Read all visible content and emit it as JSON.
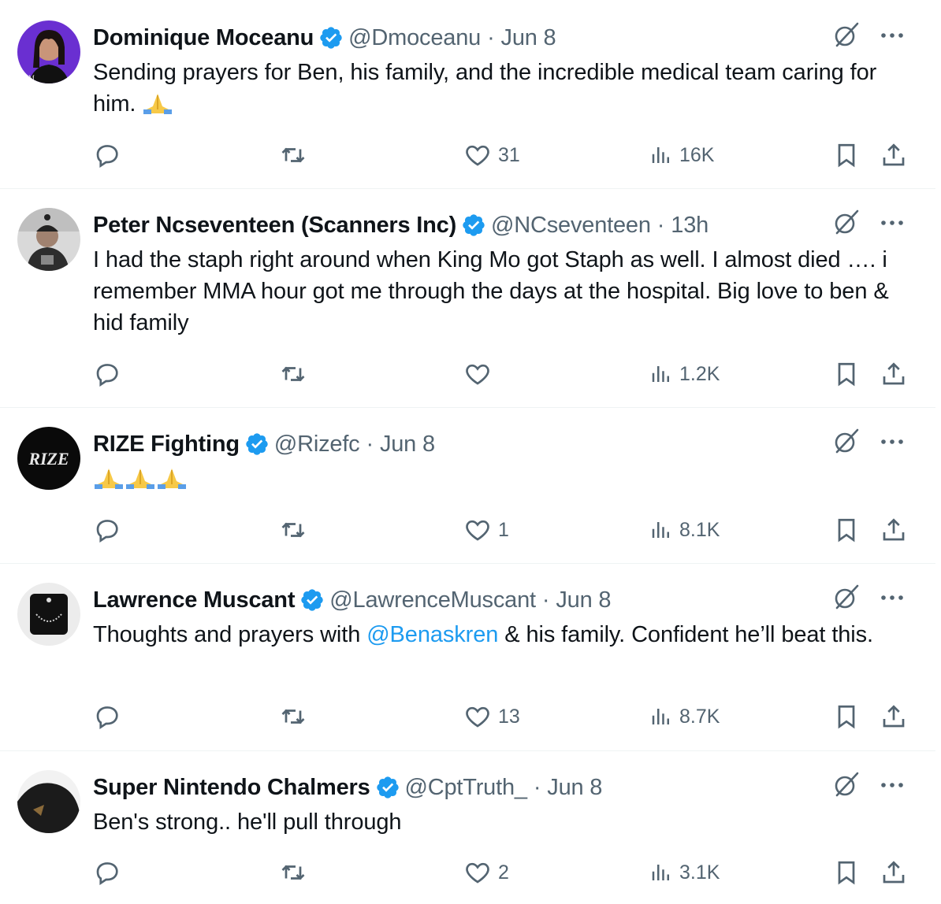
{
  "colors": {
    "verified": "#1d9bf0",
    "link": "#1d9bf0",
    "muted": "#536471"
  },
  "icons": {
    "verified": "verified-badge-icon",
    "grok": "grok-icon",
    "more": "more-icon",
    "reply": "reply-icon",
    "repost": "repost-icon",
    "like": "like-icon",
    "views": "views-icon",
    "bookmark": "bookmark-icon",
    "share": "share-icon",
    "emoji": "folded-hands-emoji"
  },
  "tweets": [
    {
      "name": "Dominique Moceanu",
      "handle": "@Dmoceanu",
      "time": "Jun 8",
      "text": "Sending prayers for Ben, his family, and the incredible medical team caring for him.",
      "likes": "31",
      "views": "16K"
    },
    {
      "name": "Peter Ncseventeen (Scanners Inc)",
      "handle": "@NCseventeen",
      "time": "13h",
      "text": "I had the staph right around when King Mo got Staph as well. I almost died …. i remember MMA hour got me through the days at the hospital. Big love to ben & hid family",
      "likes": "",
      "views": "1.2K"
    },
    {
      "name": "RIZE Fighting",
      "handle": "@Rizefc",
      "time": "Jun 8",
      "text": "",
      "likes": "1",
      "views": "8.1K",
      "avatar_text": "RIZE"
    },
    {
      "name": "Lawrence Muscant",
      "handle": "@LawrenceMuscant",
      "time": "Jun 8",
      "text_before": "Thoughts and prayers with ",
      "mention": "@Benaskren",
      "text_after": " & his family. Confident he’ll beat this.",
      "likes": "13",
      "views": "8.7K"
    },
    {
      "name": "Super Nintendo Chalmers",
      "handle": "@CptTruth_",
      "time": "Jun 8",
      "text": "Ben's strong.. he'll pull through",
      "likes": "2",
      "views": "3.1K"
    }
  ]
}
